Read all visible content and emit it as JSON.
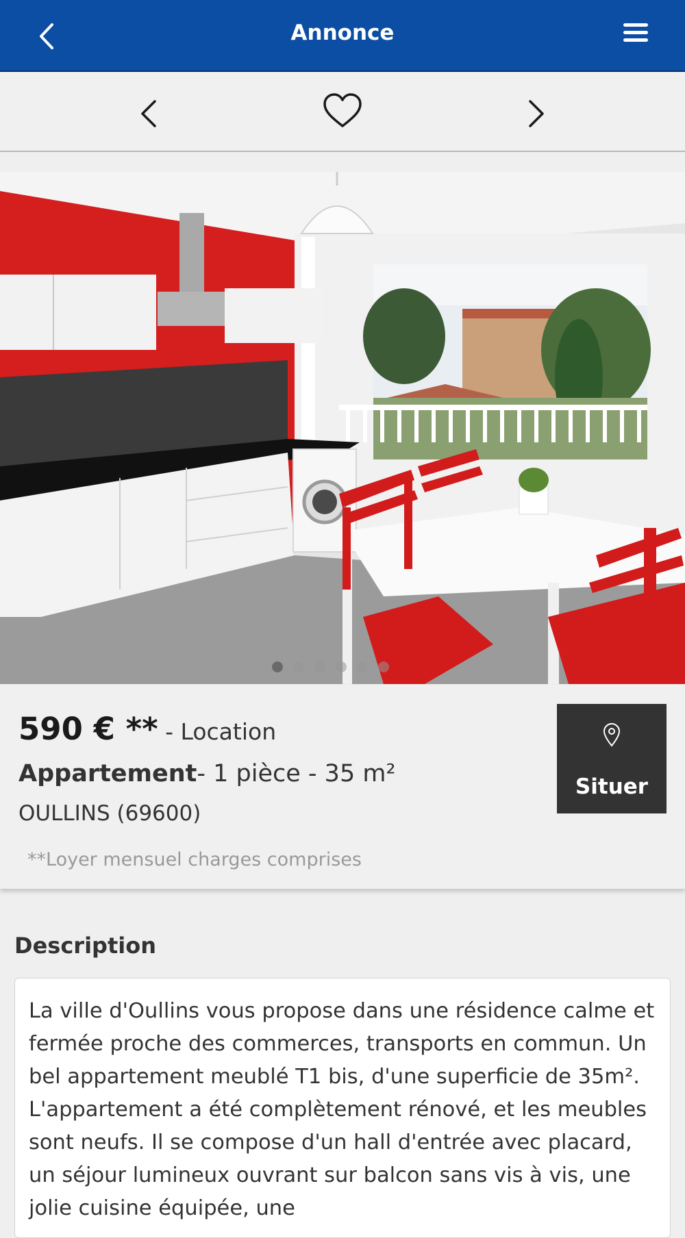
{
  "header": {
    "title": "Annonce",
    "back_icon": "chevron-left-icon",
    "menu_icon": "hamburger-menu-icon",
    "bg_color": "#0c4ea3"
  },
  "navbar": {
    "prev_icon": "chevron-left-icon",
    "favorite_icon": "heart-icon",
    "next_icon": "chevron-right-icon"
  },
  "gallery": {
    "photo_description": "kitchen",
    "photo_count": 6,
    "active_index": 0
  },
  "listing": {
    "price": "590 € **",
    "rent_type": " - Location",
    "property_type": "Appartement",
    "details": "- 1 pièce - 35 m²",
    "city": "OULLINS (69600)",
    "note": "**Loyer mensuel charges comprises",
    "locate_button": "Situer",
    "locate_icon": "map-pin-icon"
  },
  "description": {
    "title": "Description",
    "text": "La ville d'Oullins vous propose dans une résidence calme et fermée proche des commerces, transports en commun. Un bel appartement meublé T1 bis, d'une superficie de 35m². L'appartement a été complètement rénové, et les meubles sont neufs. Il se compose d'un hall d'entrée avec placard, un séjour lumineux ouvrant sur balcon sans vis à vis, une jolie cuisine équipée, une"
  }
}
